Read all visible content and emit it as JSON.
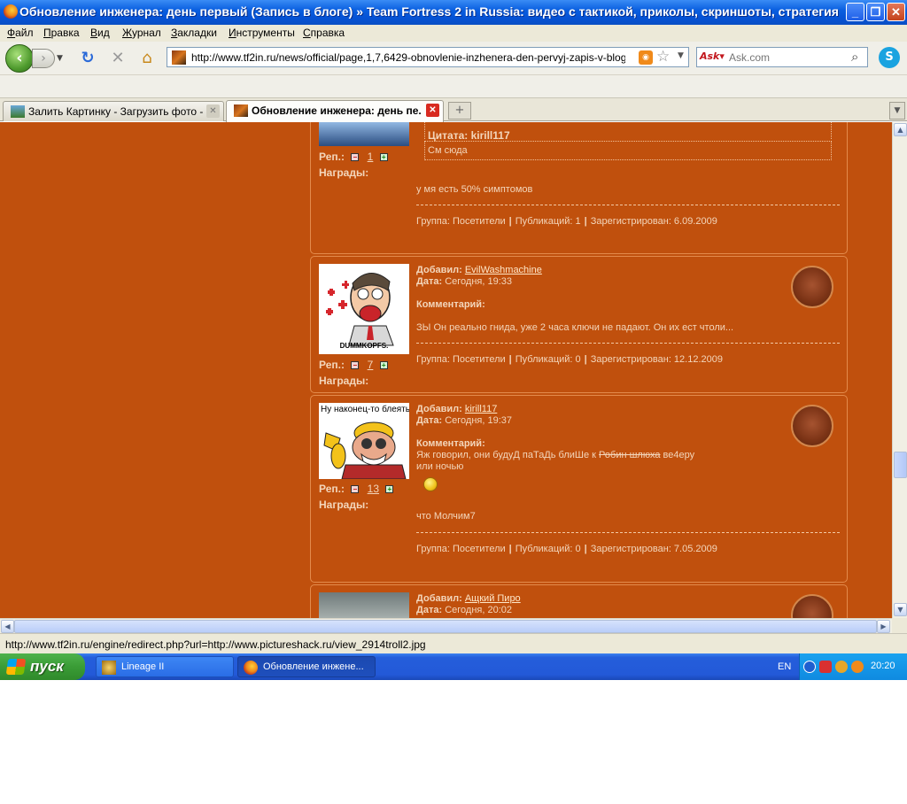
{
  "window": {
    "title": "Обновление инженера: день первый (Запись в блоге) » Team Fortress 2 in Russia: видео с тактикой, приколы, скриншоты, стратегия и секре..."
  },
  "menu": [
    "Файл",
    "Правка",
    "Вид",
    "Журнал",
    "Закладки",
    "Инструменты",
    "Справка"
  ],
  "nav": {
    "url": "http://www.tf2in.ru/news/official/page,1,7,6429-obnovlenie-inzhenera-den-pervyj-zapis-v-bloge.html#",
    "search_placeholder": "Ask.com"
  },
  "tabs": [
    {
      "label": "Залить Картинку - Загрузить фото - ...",
      "active": false
    },
    {
      "label": "Обновление инженера: день пе...",
      "active": true
    }
  ],
  "comments": {
    "labels": {
      "rep": "Реп.:",
      "awards": "Награды:",
      "added": "Добавил:",
      "date": "Дата:",
      "comment": "Комментарий:",
      "quote_header": "Цитата: kirill117"
    },
    "c0": {
      "rep": "1",
      "quote_text": "См сюда",
      "text": "у мя есть 50% симптомов",
      "group": "Группа: Посетители",
      "posts": "Публикаций: 1",
      "registered": "Зарегистрирован: 6.09.2009"
    },
    "c1": {
      "author": "EvilWashmachine",
      "date": "Сегодня, 19:33",
      "rep": "7",
      "text": "ЗЫ Он реально гнида, уже 2 часа ключи не падают. Он их ест чтоли...",
      "group": "Группа: Посетители",
      "posts": "Публикаций: 0",
      "registered": "Зарегистрирован: 12.12.2009",
      "avatar_caption": "DUMMKOPFS."
    },
    "c2": {
      "author": "kirill117",
      "date": "Сегодня, 19:37",
      "rep": "13",
      "text_line1_a": "Яж говорил, они будуД паТаДь блиШе к ",
      "text_line1_strike": "Робин шлюха",
      "text_line1_b": " ве4еру",
      "text_line2": "или ночью",
      "text_after": "что Молчим7",
      "group": "Группа: Посетители",
      "posts": "Публикаций: 0",
      "registered": "Зарегистрирован: 7.05.2009",
      "avatar_caption": "Ну наконец-то блеять!"
    },
    "c3": {
      "author": "Ащкий Пиро",
      "date": "Сегодня, 20:02"
    }
  },
  "status_text": "http://www.tf2in.ru/engine/redirect.php?url=http://www.pictureshack.ru/view_2914troll2.jpg",
  "taskbar": {
    "start_label": "пуск",
    "buttons": [
      "Lineage II",
      "Обновление инжене..."
    ],
    "lang": "EN",
    "clock": "20:20"
  }
}
